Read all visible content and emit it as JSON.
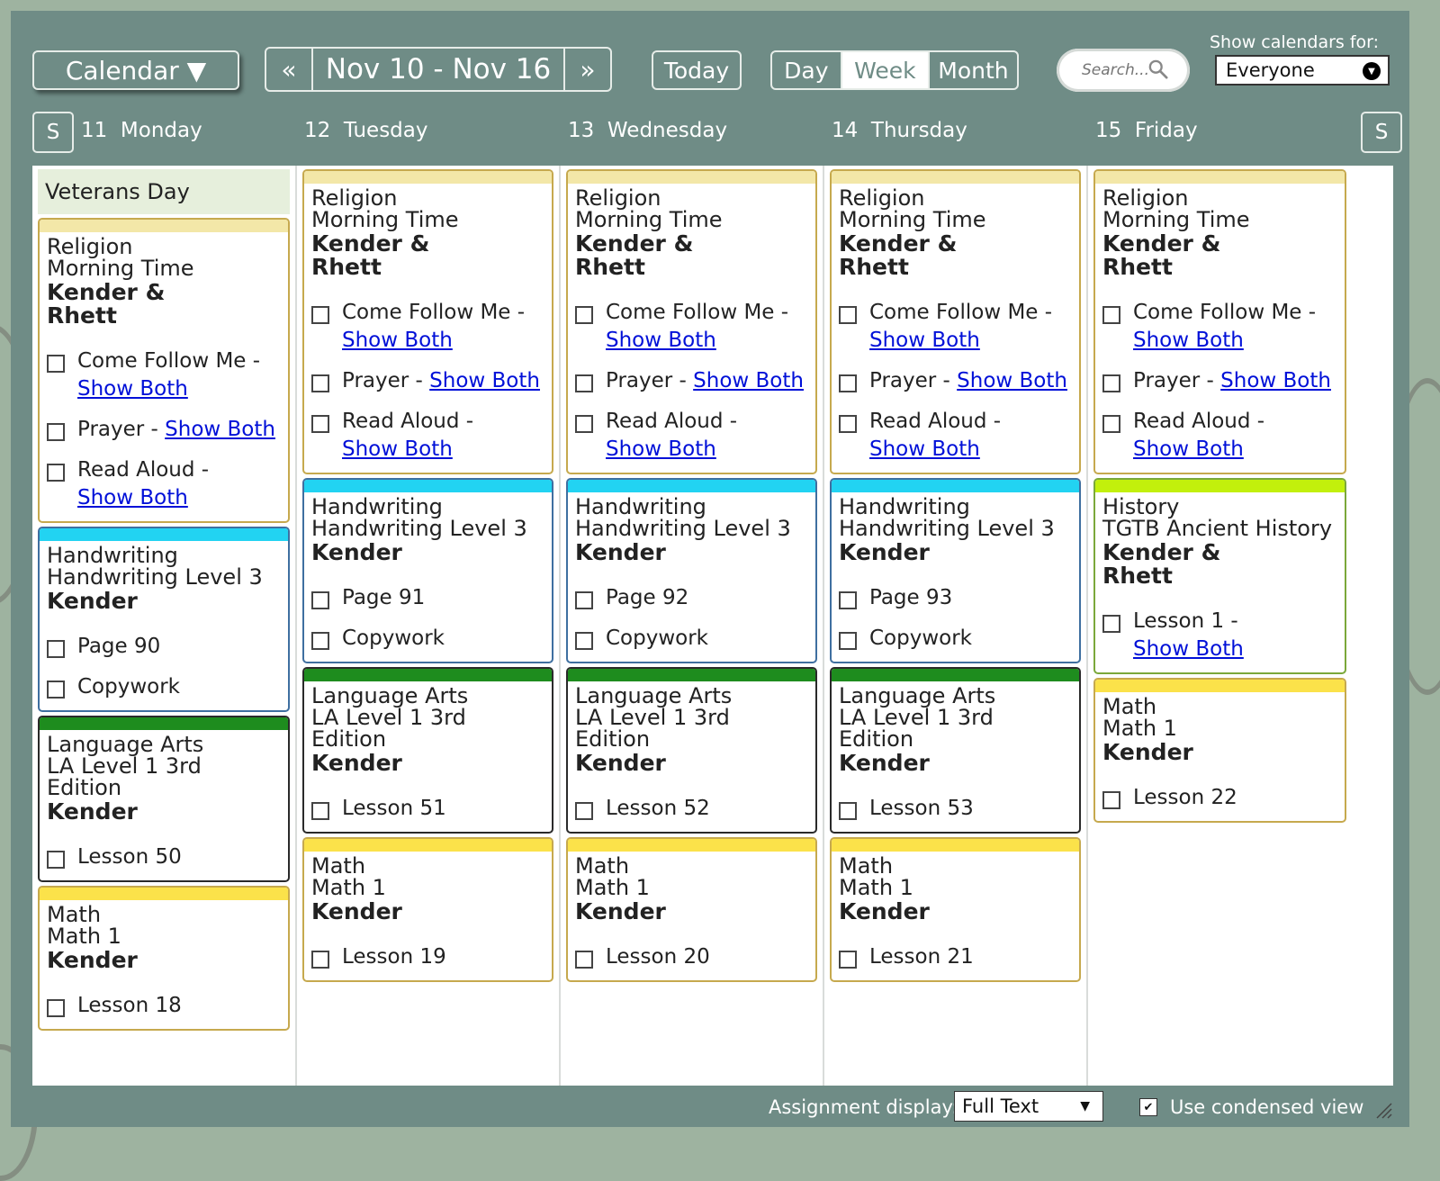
{
  "toolbar": {
    "calendar_label": "Calendar ▼",
    "prev_label": "«",
    "next_label": "»",
    "date_range": "Nov 10 - Nov 16",
    "today_label": "Today",
    "views": [
      {
        "label": "Day",
        "active": false
      },
      {
        "label": "Week",
        "active": true
      },
      {
        "label": "Month",
        "active": false
      }
    ],
    "search_placeholder": "Search...",
    "show_calendars_label": "Show calendars for:",
    "show_calendars_value": "Everyone"
  },
  "nav": {
    "prev_weekend": "S",
    "next_weekend": "S"
  },
  "days": [
    {
      "date": "11",
      "name": "Monday",
      "holiday": "Veterans Day",
      "cards": [
        {
          "color": "#f3e7a8",
          "style": "gold",
          "subject": "Religion",
          "course": "Morning Time",
          "student": "Kender &\nRhett",
          "assignments": [
            {
              "text": "Come Follow Me -",
              "link": "Show Both",
              "wrap": true
            },
            {
              "text": "Prayer -",
              "link": "Show Both",
              "wrap": false
            },
            {
              "text": "Read Aloud -",
              "link": "Show Both",
              "wrap": true
            }
          ]
        },
        {
          "color": "#22d3f2",
          "style": "blue",
          "subject": "Handwriting",
          "course": "Handwriting Level 3",
          "student": "Kender",
          "assignments": [
            {
              "text": "Page 90"
            },
            {
              "text": "Copywork"
            }
          ]
        },
        {
          "color": "#1e8c1e",
          "style": "dark",
          "subject": "Language Arts",
          "course": "LA Level 1 3rd\nEdition",
          "student": "Kender",
          "assignments": [
            {
              "text": "Lesson 50"
            }
          ]
        },
        {
          "color": "#fbe24a",
          "style": "gold",
          "subject": "Math",
          "course": "Math 1",
          "student": "Kender",
          "assignments": [
            {
              "text": "Lesson 18"
            }
          ]
        }
      ]
    },
    {
      "date": "12",
      "name": "Tuesday",
      "holiday": "",
      "cards": [
        {
          "color": "#f3e7a8",
          "style": "gold",
          "subject": "Religion",
          "course": "Morning Time",
          "student": "Kender &\nRhett",
          "assignments": [
            {
              "text": "Come Follow Me -",
              "link": "Show Both",
              "wrap": true
            },
            {
              "text": "Prayer -",
              "link": "Show Both",
              "wrap": false
            },
            {
              "text": "Read Aloud -",
              "link": "Show Both",
              "wrap": true
            }
          ]
        },
        {
          "color": "#22d3f2",
          "style": "blue",
          "subject": "Handwriting",
          "course": "Handwriting Level 3",
          "student": "Kender",
          "assignments": [
            {
              "text": "Page 91"
            },
            {
              "text": "Copywork"
            }
          ]
        },
        {
          "color": "#1e8c1e",
          "style": "dark",
          "subject": "Language Arts",
          "course": "LA Level 1 3rd\nEdition",
          "student": "Kender",
          "assignments": [
            {
              "text": "Lesson 51"
            }
          ]
        },
        {
          "color": "#fbe24a",
          "style": "gold",
          "subject": "Math",
          "course": "Math 1",
          "student": "Kender",
          "assignments": [
            {
              "text": "Lesson 19"
            }
          ]
        }
      ]
    },
    {
      "date": "13",
      "name": "Wednesday",
      "holiday": "",
      "cards": [
        {
          "color": "#f3e7a8",
          "style": "gold",
          "subject": "Religion",
          "course": "Morning Time",
          "student": "Kender &\nRhett",
          "assignments": [
            {
              "text": "Come Follow Me -",
              "link": "Show Both",
              "wrap": true
            },
            {
              "text": "Prayer -",
              "link": "Show Both",
              "wrap": false
            },
            {
              "text": "Read Aloud -",
              "link": "Show Both",
              "wrap": true
            }
          ]
        },
        {
          "color": "#22d3f2",
          "style": "blue",
          "subject": "Handwriting",
          "course": "Handwriting Level 3",
          "student": "Kender",
          "assignments": [
            {
              "text": "Page 92"
            },
            {
              "text": "Copywork"
            }
          ]
        },
        {
          "color": "#1e8c1e",
          "style": "dark",
          "subject": "Language Arts",
          "course": "LA Level 1 3rd\nEdition",
          "student": "Kender",
          "assignments": [
            {
              "text": "Lesson 52"
            }
          ]
        },
        {
          "color": "#fbe24a",
          "style": "gold",
          "subject": "Math",
          "course": "Math 1",
          "student": "Kender",
          "assignments": [
            {
              "text": "Lesson 20"
            }
          ]
        }
      ]
    },
    {
      "date": "14",
      "name": "Thursday",
      "holiday": "",
      "cards": [
        {
          "color": "#f3e7a8",
          "style": "gold",
          "subject": "Religion",
          "course": "Morning Time",
          "student": "Kender &\nRhett",
          "assignments": [
            {
              "text": "Come Follow Me -",
              "link": "Show Both",
              "wrap": true
            },
            {
              "text": "Prayer -",
              "link": "Show Both",
              "wrap": false
            },
            {
              "text": "Read Aloud -",
              "link": "Show Both",
              "wrap": true
            }
          ]
        },
        {
          "color": "#22d3f2",
          "style": "blue",
          "subject": "Handwriting",
          "course": "Handwriting Level 3",
          "student": "Kender",
          "assignments": [
            {
              "text": "Page 93"
            },
            {
              "text": "Copywork"
            }
          ]
        },
        {
          "color": "#1e8c1e",
          "style": "dark",
          "subject": "Language Arts",
          "course": "LA Level 1 3rd\nEdition",
          "student": "Kender",
          "assignments": [
            {
              "text": "Lesson 53"
            }
          ]
        },
        {
          "color": "#fbe24a",
          "style": "gold",
          "subject": "Math",
          "course": "Math 1",
          "student": "Kender",
          "assignments": [
            {
              "text": "Lesson 21"
            }
          ]
        }
      ]
    },
    {
      "date": "15",
      "name": "Friday",
      "holiday": "",
      "cards": [
        {
          "color": "#f3e7a8",
          "style": "gold",
          "subject": "Religion",
          "course": "Morning Time",
          "student": "Kender &\nRhett",
          "assignments": [
            {
              "text": "Come Follow Me -",
              "link": "Show Both",
              "wrap": true
            },
            {
              "text": "Prayer -",
              "link": "Show Both",
              "wrap": false
            },
            {
              "text": "Read Aloud -",
              "link": "Show Both",
              "wrap": true
            }
          ]
        },
        {
          "color": "#c2f00c",
          "style": "green-bar",
          "subject": "History",
          "course": "TGTB Ancient History",
          "student": "Kender &\nRhett",
          "assignments": [
            {
              "text": "Lesson 1 -",
              "link": "Show Both",
              "wrap": true
            }
          ]
        },
        {
          "color": "#fbe24a",
          "style": "gold",
          "subject": "Math",
          "course": "Math 1",
          "student": "Kender",
          "assignments": [
            {
              "text": "Lesson 22"
            }
          ]
        }
      ]
    }
  ],
  "footer": {
    "assignment_display_label": "Assignment display:",
    "assignment_display_value": "Full Text",
    "condensed_label": "Use condensed view",
    "condensed_checked": true
  },
  "colors": {
    "panel": "#6f8c86",
    "background": "#9eb3a0",
    "link": "#0010d8"
  }
}
